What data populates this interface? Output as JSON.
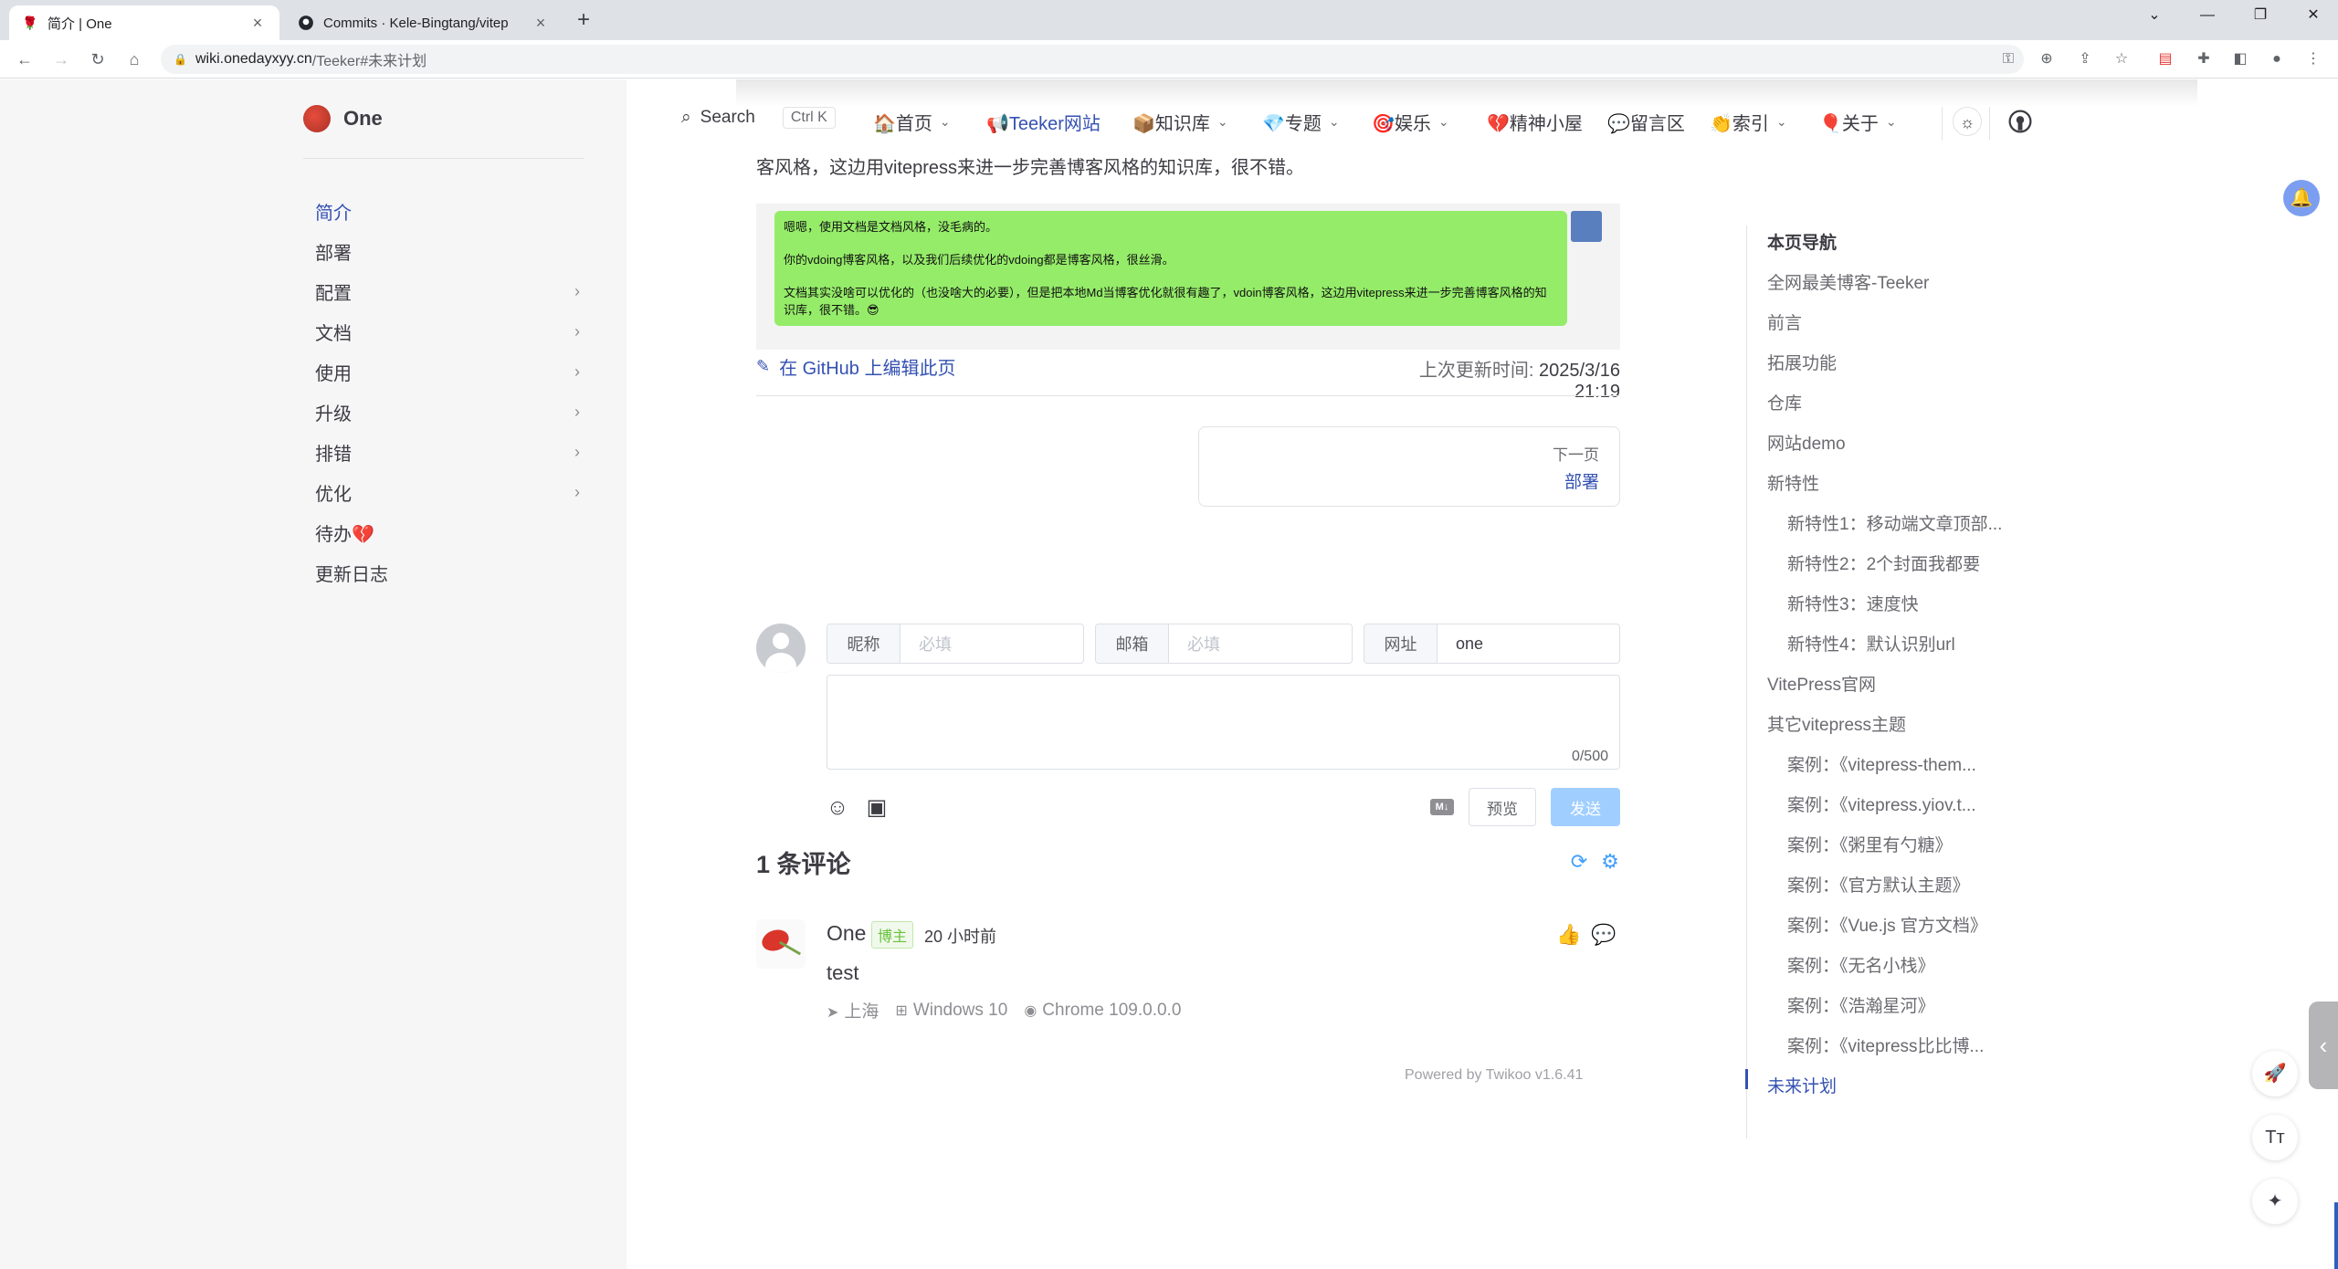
{
  "browser": {
    "tabs": [
      {
        "label": "简介 | One",
        "active": true
      },
      {
        "label": "Commits · Kele-Bingtang/vitep",
        "active": false
      }
    ],
    "url_host": "wiki.onedayxyy.cn",
    "url_path": "/Teeker#未来计划"
  },
  "site": {
    "name": "One",
    "search_label": "Search",
    "search_kbd": "Ctrl K"
  },
  "sidebar": {
    "items": [
      {
        "label": "简介",
        "active": true,
        "expandable": false
      },
      {
        "label": "部署",
        "active": false,
        "expandable": false
      },
      {
        "label": "配置",
        "active": false,
        "expandable": true
      },
      {
        "label": "文档",
        "active": false,
        "expandable": true
      },
      {
        "label": "使用",
        "active": false,
        "expandable": true
      },
      {
        "label": "升级",
        "active": false,
        "expandable": true
      },
      {
        "label": "排错",
        "active": false,
        "expandable": true
      },
      {
        "label": "优化",
        "active": false,
        "expandable": true
      },
      {
        "label": "待办💔",
        "active": false,
        "expandable": false
      },
      {
        "label": "更新日志",
        "active": false,
        "expandable": false
      }
    ]
  },
  "nav": {
    "items": [
      {
        "label": "🏠首页",
        "dropdown": true
      },
      {
        "label": "📢Teeker网站",
        "dropdown": false
      },
      {
        "label": "📦知识库",
        "dropdown": true
      },
      {
        "label": "💎专题",
        "dropdown": true
      },
      {
        "label": "🎯娱乐",
        "dropdown": true
      },
      {
        "label": "💔精神小屋",
        "dropdown": false
      },
      {
        "label": "💬留言区",
        "dropdown": false
      },
      {
        "label": "👏索引",
        "dropdown": true
      },
      {
        "label": "🎈关于",
        "dropdown": true
      }
    ]
  },
  "article": {
    "cut_text": "客风格，这边用vitepress来进一步完善博客风格的知识库，很不错。",
    "chat_lines": [
      "嗯嗯，使用文档是文档风格，没毛病的。",
      "你的vdoing博客风格，以及我们后续优化的vdoing都是博客风格，很丝滑。",
      "文档其实没啥可以优化的（也没啥大的必要），但是把本地Md当博客优化就很有趣了，vdoin博客风格，这边用vitepress来进一步完善博客风格的知识库，很不错。😎"
    ],
    "edit_link": "在 GitHub 上编辑此页",
    "updated_label": "上次更新时间:",
    "updated_value": "2025/3/16 21:19",
    "next_label": "下一页",
    "next_value": "部署"
  },
  "comment_form": {
    "nick_label": "昵称",
    "nick_placeholder": "必填",
    "mail_label": "邮箱",
    "mail_placeholder": "必填",
    "url_label": "网址",
    "url_value": "one",
    "counter": "0/500",
    "preview_label": "预览",
    "send_label": "发送"
  },
  "comments": {
    "count_title": "1 条评论",
    "items": [
      {
        "nick": "One",
        "badge": "博主",
        "time": "20 小时前",
        "text": "test",
        "location": "上海",
        "os": "Windows 10",
        "browser": "Chrome 109.0.0.0"
      }
    ],
    "powered": "Powered by Twikoo v1.6.41"
  },
  "outline": {
    "title": "本页导航",
    "items": [
      {
        "label": "全网最美博客-Teeker",
        "level": 1
      },
      {
        "label": "前言",
        "level": 1
      },
      {
        "label": "拓展功能",
        "level": 1
      },
      {
        "label": "仓库",
        "level": 1
      },
      {
        "label": "网站demo",
        "level": 1
      },
      {
        "label": "新特性",
        "level": 1
      },
      {
        "label": "新特性1：移动端文章顶部...",
        "level": 2
      },
      {
        "label": "新特性2：2个封面我都要",
        "level": 2
      },
      {
        "label": "新特性3：速度快",
        "level": 2
      },
      {
        "label": "新特性4：默认识别url",
        "level": 2
      },
      {
        "label": "VitePress官网",
        "level": 1
      },
      {
        "label": "其它vitepress主题",
        "level": 1
      },
      {
        "label": "案例：《vitepress-them...",
        "level": 2
      },
      {
        "label": "案例：《vitepress.yiov.t...",
        "level": 2
      },
      {
        "label": "案例：《粥里有勺糖》",
        "level": 2
      },
      {
        "label": "案例：《官方默认主题》",
        "level": 2
      },
      {
        "label": "案例：《Vue.js 官方文档》",
        "level": 2
      },
      {
        "label": "案例：《无名小栈》",
        "level": 2
      },
      {
        "label": "案例：《浩瀚星河》",
        "level": 2
      },
      {
        "label": "案例：《vitepress比比博...",
        "level": 2
      },
      {
        "label": "未来计划",
        "level": 1,
        "active": true
      }
    ]
  },
  "float_buttons": {
    "fontsize_label": "Tт"
  },
  "colors": {
    "brand": "#3451b2",
    "sidebar_bg": "#f6f6f7",
    "twikoo_blue": "#409eff",
    "wechat_green": "#95ec69"
  }
}
